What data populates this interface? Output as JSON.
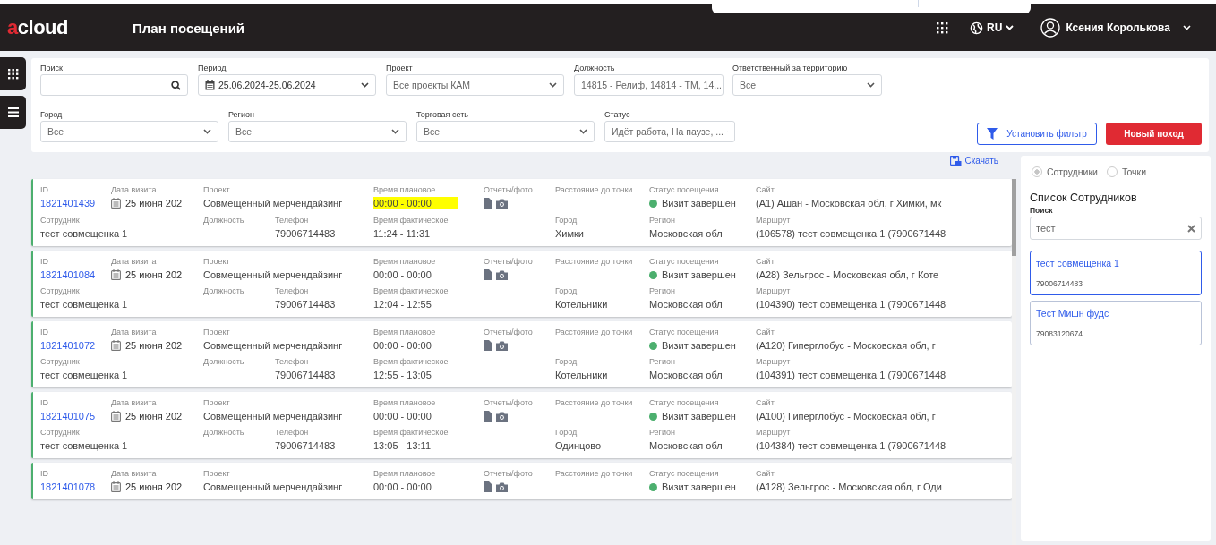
{
  "header": {
    "logo": "acloud",
    "title": "План посещений",
    "language": "RU",
    "user": "Ксения Королькова"
  },
  "filters": [
    {
      "label": "Поиск",
      "kind": "search"
    },
    {
      "label": "Период",
      "kind": "date",
      "value": "25.06.2024-25.06.2024"
    },
    {
      "label": "Проект",
      "kind": "select",
      "value": "Все проекты КАМ"
    },
    {
      "label": "Должность",
      "kind": "select",
      "value": "14815 - Релиф, 14814 - ТМ, 14..."
    },
    {
      "label": "Ответственный за территорию",
      "kind": "select",
      "value": "Все"
    },
    {
      "label": "Город",
      "kind": "select",
      "value": "Все"
    },
    {
      "label": "Регион",
      "kind": "select",
      "value": "Все"
    },
    {
      "label": "Торговая сеть",
      "kind": "select",
      "value": "Все"
    },
    {
      "label": "Статус",
      "kind": "select",
      "value": "Идёт работа, На паузе, ..."
    }
  ],
  "filter_button": "Установить фильтр",
  "new_button": "Новый поход",
  "download": "Скачать",
  "visits": [
    {
      "top": [
        {
          "kind": "link",
          "label": "ID",
          "value": "1821401439"
        },
        {
          "kind": "date",
          "label": "Дата визита",
          "value": "25 июня 202"
        },
        {
          "kind": "text",
          "label": "Проект",
          "value": "Совмещенный мерчендайзинг"
        },
        {
          "kind": "time",
          "label": "Время плановое",
          "value": "00:00 - 00:00",
          "highlighted": true
        },
        {
          "kind": "files",
          "label": "Отчеты/фото"
        },
        {
          "kind": "text",
          "label": "Расстояние до точки"
        },
        {
          "kind": "status",
          "label": "Статус посещения",
          "value": "Визит завершен",
          "color": "#4caf6e"
        },
        {
          "kind": "text",
          "label": "Сайт",
          "value": "(А1) Ашан - Московская обл, г Химки, мк"
        }
      ],
      "bottom": [
        {
          "kind": "text",
          "label": "Сотрудник",
          "value": "тест совмещенка 1"
        },
        {
          "kind": "text",
          "label": "Должность"
        },
        {
          "kind": "text",
          "label": "Телефон",
          "value": "79006714483"
        },
        {
          "kind": "text",
          "label": "Время фактическое",
          "value": "11:24 - 11:31"
        },
        {
          "kind": "text",
          "label": "Город",
          "value": "Химки"
        },
        {
          "kind": "text",
          "label": "Регион",
          "value": "Московская обл"
        },
        {
          "kind": "text",
          "label": "Маршрут",
          "value": "(106578) тест совмещенка 1 (7900671448"
        }
      ]
    },
    {
      "top": [
        {
          "kind": "link",
          "label": "ID",
          "value": "1821401084"
        },
        {
          "kind": "date",
          "label": "Дата визита",
          "value": "25 июня 202"
        },
        {
          "kind": "text",
          "label": "Проект",
          "value": "Совмещенный мерчендайзинг"
        },
        {
          "kind": "time",
          "label": "Время плановое",
          "value": "00:00 - 00:00",
          "highlighted": false
        },
        {
          "kind": "files",
          "label": "Отчеты/фото"
        },
        {
          "kind": "text",
          "label": "Расстояние до точки"
        },
        {
          "kind": "status",
          "label": "Статус посещения",
          "value": "Визит завершен",
          "color": "#4caf6e"
        },
        {
          "kind": "text",
          "label": "Сайт",
          "value": "(А28) Зельгрос - Московская обл, г Коте"
        }
      ],
      "bottom": [
        {
          "kind": "text",
          "label": "Сотрудник",
          "value": "тест совмещенка 1"
        },
        {
          "kind": "text",
          "label": "Должность"
        },
        {
          "kind": "text",
          "label": "Телефон",
          "value": "79006714483"
        },
        {
          "kind": "text",
          "label": "Время фактическое",
          "value": "12:04 - 12:55"
        },
        {
          "kind": "text",
          "label": "Город",
          "value": "Котельники"
        },
        {
          "kind": "text",
          "label": "Регион",
          "value": "Московская обл"
        },
        {
          "kind": "text",
          "label": "Маршрут",
          "value": "(104390) тест совмещенка 1 (7900671448"
        }
      ]
    },
    {
      "top": [
        {
          "kind": "link",
          "label": "ID",
          "value": "1821401072"
        },
        {
          "kind": "date",
          "label": "Дата визита",
          "value": "25 июня 202"
        },
        {
          "kind": "text",
          "label": "Проект",
          "value": "Совмещенный мерчендайзинг"
        },
        {
          "kind": "time",
          "label": "Время плановое",
          "value": "00:00 - 00:00",
          "highlighted": false
        },
        {
          "kind": "files",
          "label": "Отчеты/фото"
        },
        {
          "kind": "text",
          "label": "Расстояние до точки"
        },
        {
          "kind": "status",
          "label": "Статус посещения",
          "value": "Визит завершен",
          "color": "#4caf6e"
        },
        {
          "kind": "text",
          "label": "Сайт",
          "value": "(А120) Гиперглобус - Московская обл, г"
        }
      ],
      "bottom": [
        {
          "kind": "text",
          "label": "Сотрудник",
          "value": "тест совмещенка 1"
        },
        {
          "kind": "text",
          "label": "Должность"
        },
        {
          "kind": "text",
          "label": "Телефон",
          "value": "79006714483"
        },
        {
          "kind": "text",
          "label": "Время фактическое",
          "value": "12:55 - 13:05"
        },
        {
          "kind": "text",
          "label": "Город",
          "value": "Котельники"
        },
        {
          "kind": "text",
          "label": "Регион",
          "value": "Московская обл"
        },
        {
          "kind": "text",
          "label": "Маршрут",
          "value": "(104391) тест совмещенка 1 (7900671448"
        }
      ]
    },
    {
      "top": [
        {
          "kind": "link",
          "label": "ID",
          "value": "1821401075"
        },
        {
          "kind": "date",
          "label": "Дата визита",
          "value": "25 июня 202"
        },
        {
          "kind": "text",
          "label": "Проект",
          "value": "Совмещенный мерчендайзинг"
        },
        {
          "kind": "time",
          "label": "Время плановое",
          "value": "00:00 - 00:00",
          "highlighted": false
        },
        {
          "kind": "files",
          "label": "Отчеты/фото"
        },
        {
          "kind": "text",
          "label": "Расстояние до точки"
        },
        {
          "kind": "status",
          "label": "Статус посещения",
          "value": "Визит завершен",
          "color": "#4caf6e"
        },
        {
          "kind": "text",
          "label": "Сайт",
          "value": "(А100) Гиперглобус - Московская обл, г"
        }
      ],
      "bottom": [
        {
          "kind": "text",
          "label": "Сотрудник",
          "value": "тест совмещенка 1"
        },
        {
          "kind": "text",
          "label": "Должность"
        },
        {
          "kind": "text",
          "label": "Телефон",
          "value": "79006714483"
        },
        {
          "kind": "text",
          "label": "Время фактическое",
          "value": "13:05 - 13:11"
        },
        {
          "kind": "text",
          "label": "Город",
          "value": "Одинцово"
        },
        {
          "kind": "text",
          "label": "Регион",
          "value": "Московская обл"
        },
        {
          "kind": "text",
          "label": "Маршрут",
          "value": "(104384) тест совмещенка 1 (7900671448"
        }
      ]
    },
    {
      "top": [
        {
          "kind": "link",
          "label": "ID",
          "value": "1821401078"
        },
        {
          "kind": "date",
          "label": "Дата визита",
          "value": "25 июня 202"
        },
        {
          "kind": "text",
          "label": "Проект",
          "value": "Совмещенный мерчендайзинг"
        },
        {
          "kind": "time",
          "label": "Время плановое",
          "value": "00:00 - 00:00",
          "highlighted": false
        },
        {
          "kind": "files",
          "label": "Отчеты/фото"
        },
        {
          "kind": "text",
          "label": "Расстояние до точки"
        },
        {
          "kind": "status",
          "label": "Статус посещения",
          "value": "Визит завершен",
          "color": "#4caf6e"
        },
        {
          "kind": "text",
          "label": "Сайт",
          "value": "(А128) Зельгрос - Московская обл, г Оди"
        }
      ]
    }
  ],
  "side_panel": {
    "modes": [
      {
        "label": "Сотрудники",
        "selected": true
      },
      {
        "label": "Точки",
        "selected": false
      }
    ],
    "title": "Список Сотрудников",
    "search_label": "Поиск",
    "search_value": "тест",
    "results": [
      {
        "name": "тест совмещенка 1",
        "phone": "79006714483",
        "selected": true
      },
      {
        "name": "Тест Мишн фудс",
        "phone": "79083120674",
        "selected": false
      }
    ]
  }
}
